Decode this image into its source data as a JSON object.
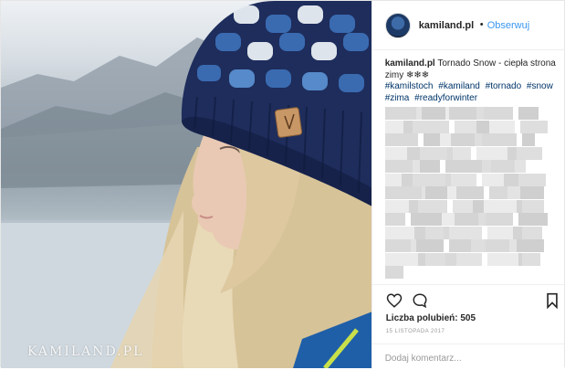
{
  "post": {
    "image": {
      "watermark": "KAMILAND.PL",
      "alt_subject": "woman in knitted blue beanie"
    },
    "header": {
      "username": "kamiland.pl",
      "separator": "•",
      "follow_label": "Obserwuj"
    },
    "caption": {
      "username": "kamiland.pl",
      "text": "Tornado Snow - ciepła strona zimy ❄❄❄",
      "hashtags": [
        "#kamilstoch",
        "#kamiland",
        "#tornado",
        "#snow",
        "#zima",
        "#readyforwinter"
      ]
    },
    "comments_pixelated": true,
    "actions": {
      "icons": [
        "heart-icon",
        "comment-icon",
        "bookmark-icon"
      ],
      "likes_label": "Liczba polubień: 505",
      "date": "15 LISTOPADA 2017"
    },
    "add_comment": {
      "placeholder": "Dodaj komentarz..."
    },
    "colors": {
      "link": "#3897f0",
      "hashtag": "#003569",
      "text": "#262626",
      "muted": "#999999",
      "border": "#efefef",
      "beanie_navy": "#1e2d5c",
      "beanie_blue": "#3c6fb6",
      "beanie_white": "#e9eef3",
      "hair": "#d8c49a"
    }
  }
}
